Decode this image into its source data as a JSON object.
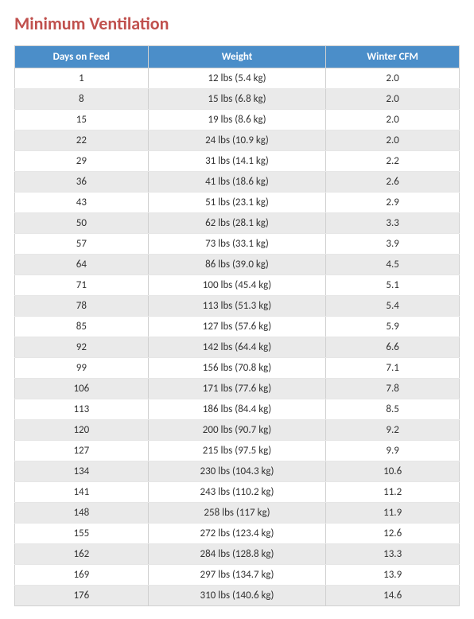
{
  "title": "Minimum Ventilation",
  "columns": {
    "days": "Days on Feed",
    "weight": "Weight",
    "cfm": "Winter CFM"
  },
  "rows": [
    {
      "days": "1",
      "weight": "12 lbs (5.4 kg)",
      "cfm": "2.0"
    },
    {
      "days": "8",
      "weight": "15 lbs (6.8 kg)",
      "cfm": "2.0"
    },
    {
      "days": "15",
      "weight": "19 lbs (8.6 kg)",
      "cfm": "2.0"
    },
    {
      "days": "22",
      "weight": "24 lbs (10.9 kg)",
      "cfm": "2.0"
    },
    {
      "days": "29",
      "weight": "31 lbs (14.1 kg)",
      "cfm": "2.2"
    },
    {
      "days": "36",
      "weight": "41 lbs (18.6 kg)",
      "cfm": "2.6"
    },
    {
      "days": "43",
      "weight": "51 lbs (23.1 kg)",
      "cfm": "2.9"
    },
    {
      "days": "50",
      "weight": "62 lbs (28.1 kg)",
      "cfm": "3.3"
    },
    {
      "days": "57",
      "weight": "73 lbs (33.1 kg)",
      "cfm": "3.9"
    },
    {
      "days": "64",
      "weight": "86 lbs (39.0 kg)",
      "cfm": "4.5"
    },
    {
      "days": "71",
      "weight": "100 lbs (45.4 kg)",
      "cfm": "5.1"
    },
    {
      "days": "78",
      "weight": "113 lbs (51.3 kg)",
      "cfm": "5.4"
    },
    {
      "days": "85",
      "weight": "127 lbs (57.6 kg)",
      "cfm": "5.9"
    },
    {
      "days": "92",
      "weight": "142 lbs (64.4 kg)",
      "cfm": "6.6"
    },
    {
      "days": "99",
      "weight": "156 lbs (70.8 kg)",
      "cfm": "7.1"
    },
    {
      "days": "106",
      "weight": "171 lbs (77.6 kg)",
      "cfm": "7.8"
    },
    {
      "days": "113",
      "weight": "186 lbs (84.4 kg)",
      "cfm": "8.5"
    },
    {
      "days": "120",
      "weight": "200 lbs (90.7 kg)",
      "cfm": "9.2"
    },
    {
      "days": "127",
      "weight": "215 lbs (97.5 kg)",
      "cfm": "9.9"
    },
    {
      "days": "134",
      "weight": "230 lbs (104.3 kg)",
      "cfm": "10.6"
    },
    {
      "days": "141",
      "weight": "243 lbs (110.2 kg)",
      "cfm": "11.2"
    },
    {
      "days": "148",
      "weight": "258 lbs (117 kg)",
      "cfm": "11.9"
    },
    {
      "days": "155",
      "weight": "272 lbs (123.4 kg)",
      "cfm": "12.6"
    },
    {
      "days": "162",
      "weight": "284 lbs (128.8 kg)",
      "cfm": "13.3"
    },
    {
      "days": "169",
      "weight": "297 lbs (134.7 kg)",
      "cfm": "13.9"
    },
    {
      "days": "176",
      "weight": "310 lbs (140.6 kg)",
      "cfm": "14.6"
    }
  ]
}
